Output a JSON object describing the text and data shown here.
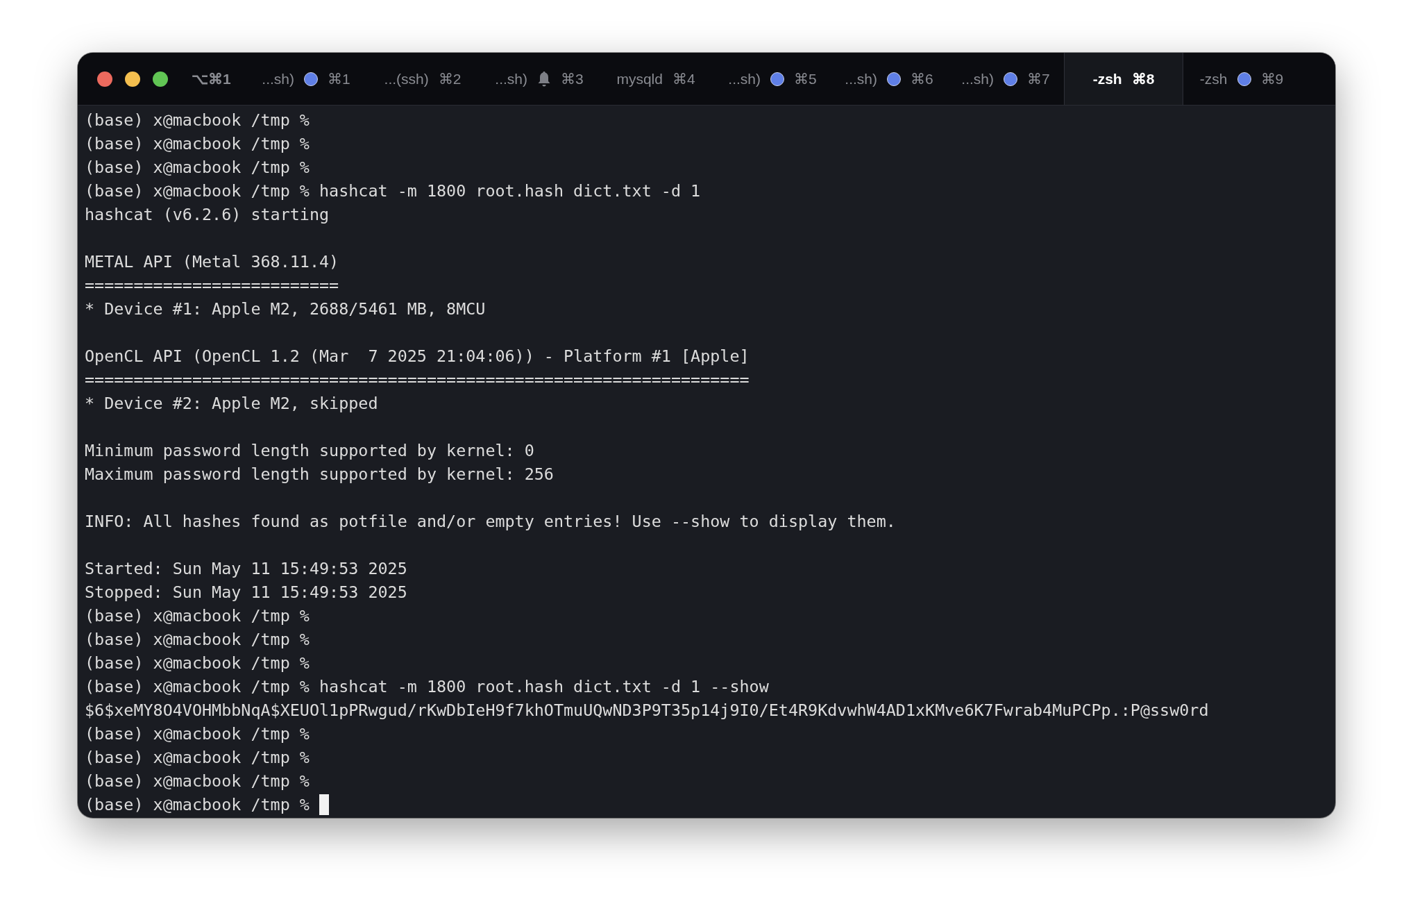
{
  "window": {
    "hotkey": "⌥⌘1"
  },
  "tabs": [
    {
      "kind": "dot",
      "title": "...sh)",
      "shortcut": "⌘1",
      "selected": false
    },
    {
      "kind": "plain",
      "title": "...(ssh)",
      "shortcut": "⌘2",
      "selected": false
    },
    {
      "kind": "bell",
      "title": "...sh)",
      "shortcut": "⌘3",
      "selected": false
    },
    {
      "kind": "plain",
      "title": "mysqld",
      "shortcut": "⌘4",
      "selected": false
    },
    {
      "kind": "dot",
      "title": "...sh)",
      "shortcut": "⌘5",
      "selected": false
    },
    {
      "kind": "dot",
      "title": "...sh)",
      "shortcut": "⌘6",
      "selected": false
    },
    {
      "kind": "dot",
      "title": "...sh)",
      "shortcut": "⌘7",
      "selected": false
    },
    {
      "kind": "plain",
      "title": "-zsh",
      "shortcut": "⌘8",
      "selected": true
    },
    {
      "kind": "dot",
      "title": "-zsh",
      "shortcut": "⌘9",
      "selected": false
    }
  ],
  "terminal": {
    "cursor": true,
    "lines": [
      {
        "kind": "text",
        "text": "(base) x@macbook /tmp %"
      },
      {
        "kind": "text",
        "text": "(base) x@macbook /tmp %"
      },
      {
        "kind": "text",
        "text": "(base) x@macbook /tmp %"
      },
      {
        "kind": "text",
        "text": "(base) x@macbook /tmp % hashcat -m 1800 root.hash dict.txt -d 1"
      },
      {
        "kind": "text",
        "text": "hashcat (v6.2.6) starting"
      },
      {
        "kind": "blank"
      },
      {
        "kind": "text",
        "text": "METAL API (Metal 368.11.4)"
      },
      {
        "kind": "text",
        "text": "=========================="
      },
      {
        "kind": "text",
        "text": "* Device #1: Apple M2, 2688/5461 MB, 8MCU"
      },
      {
        "kind": "blank"
      },
      {
        "kind": "text",
        "text": "OpenCL API (OpenCL 1.2 (Mar  7 2025 21:04:06)) - Platform #1 [Apple]"
      },
      {
        "kind": "text",
        "text": "===================================================================="
      },
      {
        "kind": "text",
        "text": "* Device #2: Apple M2, skipped"
      },
      {
        "kind": "blank"
      },
      {
        "kind": "text",
        "text": "Minimum password length supported by kernel: 0"
      },
      {
        "kind": "text",
        "text": "Maximum password length supported by kernel: 256"
      },
      {
        "kind": "blank"
      },
      {
        "kind": "text",
        "text": "INFO: All hashes found as potfile and/or empty entries! Use --show to display them."
      },
      {
        "kind": "blank"
      },
      {
        "kind": "text",
        "text": "Started: Sun May 11 15:49:53 2025"
      },
      {
        "kind": "text",
        "text": "Stopped: Sun May 11 15:49:53 2025"
      },
      {
        "kind": "text",
        "text": "(base) x@macbook /tmp %"
      },
      {
        "kind": "text",
        "text": "(base) x@macbook /tmp %"
      },
      {
        "kind": "text",
        "text": "(base) x@macbook /tmp %"
      },
      {
        "kind": "text",
        "text": "(base) x@macbook /tmp % hashcat -m 1800 root.hash dict.txt -d 1 --show"
      },
      {
        "kind": "text",
        "text": "$6$xeMY8O4VOHMbbNqA$XEUOl1pPRwgud/rKwDbIeH9f7khOTmuUQwND3P9T35p14j9I0/Et4R9KdvwhW4AD1xKMve6K7Fwrab4MuPCPp.:P@ssw0rd"
      },
      {
        "kind": "text",
        "text": "(base) x@macbook /tmp %"
      },
      {
        "kind": "text",
        "text": "(base) x@macbook /tmp %"
      },
      {
        "kind": "text",
        "text": "(base) x@macbook /tmp %"
      },
      {
        "kind": "text",
        "text": "(base) x@macbook /tmp %"
      }
    ]
  }
}
